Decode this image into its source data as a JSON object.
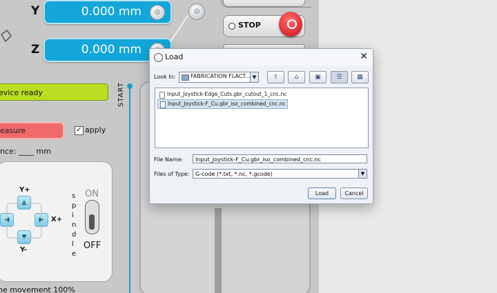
{
  "app": {
    "coords": [
      {
        "axis": "Y",
        "value": "0.000 mm",
        "zero_icon": "zero-icon"
      },
      {
        "axis": "Z",
        "value": "0.000 mm",
        "zero_icon": "zero-icon"
      }
    ],
    "stop_label": "STOP",
    "status": "evice ready",
    "measure_label": "easure",
    "apply_check": "✓",
    "apply_label": "apply",
    "distance_label": "nce: ____ mm",
    "jog": {
      "y_plus": "Y+",
      "y_minus": "Y-",
      "x_plus": "X+"
    },
    "spindle": [
      "s",
      "p",
      "i",
      "n",
      "d",
      "l",
      "e"
    ],
    "on_label": "ON",
    "off_label": "OFF",
    "start_label": "START",
    "movement_text": "he movement 100%"
  },
  "dialog": {
    "title": "Load",
    "close": "✕",
    "look_in_label": "Look In:",
    "look_in_value": "FABRICATION FLACT...",
    "files": [
      {
        "name": "Input_Joystick-Edge_Cuts.gbr_cutout_1_cnc.nc",
        "selected": false
      },
      {
        "name": "Input_Joystick-F_Cu.gbr_iso_combined_cnc.nc",
        "selected": true
      }
    ],
    "file_name_label": "File Name:",
    "file_name_value": "Input_Joystick-F_Cu.gbr_iso_combined_cnc.nc",
    "files_of_type_label": "Files of Type:",
    "files_of_type_value": "G-code (*.txt, *.nc, *.gcode)",
    "load_button": "Load",
    "cancel_button": "Cancel"
  }
}
